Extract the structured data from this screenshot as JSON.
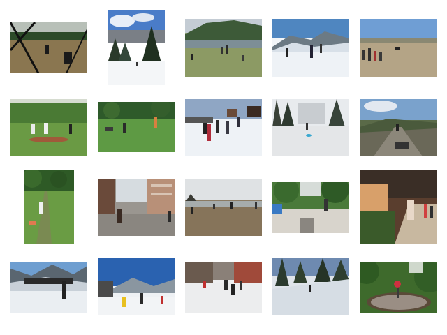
{
  "gallery": {
    "items": [
      {
        "subject": "baseball-night"
      },
      {
        "subject": "snowy-forest-trail"
      },
      {
        "subject": "lake-field-people"
      },
      {
        "subject": "snow-mountain-skiers"
      },
      {
        "subject": "dry-field-people"
      },
      {
        "subject": "baseball-pitch"
      },
      {
        "subject": "park-frisbee"
      },
      {
        "subject": "snow-kids-group"
      },
      {
        "subject": "snowy-forest-ski"
      },
      {
        "subject": "hillside-road"
      },
      {
        "subject": "field-batter"
      },
      {
        "subject": "street-walker"
      },
      {
        "subject": "beach-coastline"
      },
      {
        "subject": "park-walkway"
      },
      {
        "subject": "tree-lined-path"
      },
      {
        "subject": "ski-slope-crowd"
      },
      {
        "subject": "snow-resort"
      },
      {
        "subject": "city-snow-people"
      },
      {
        "subject": "snowy-pines-skier"
      },
      {
        "subject": "garden-sign"
      }
    ]
  }
}
